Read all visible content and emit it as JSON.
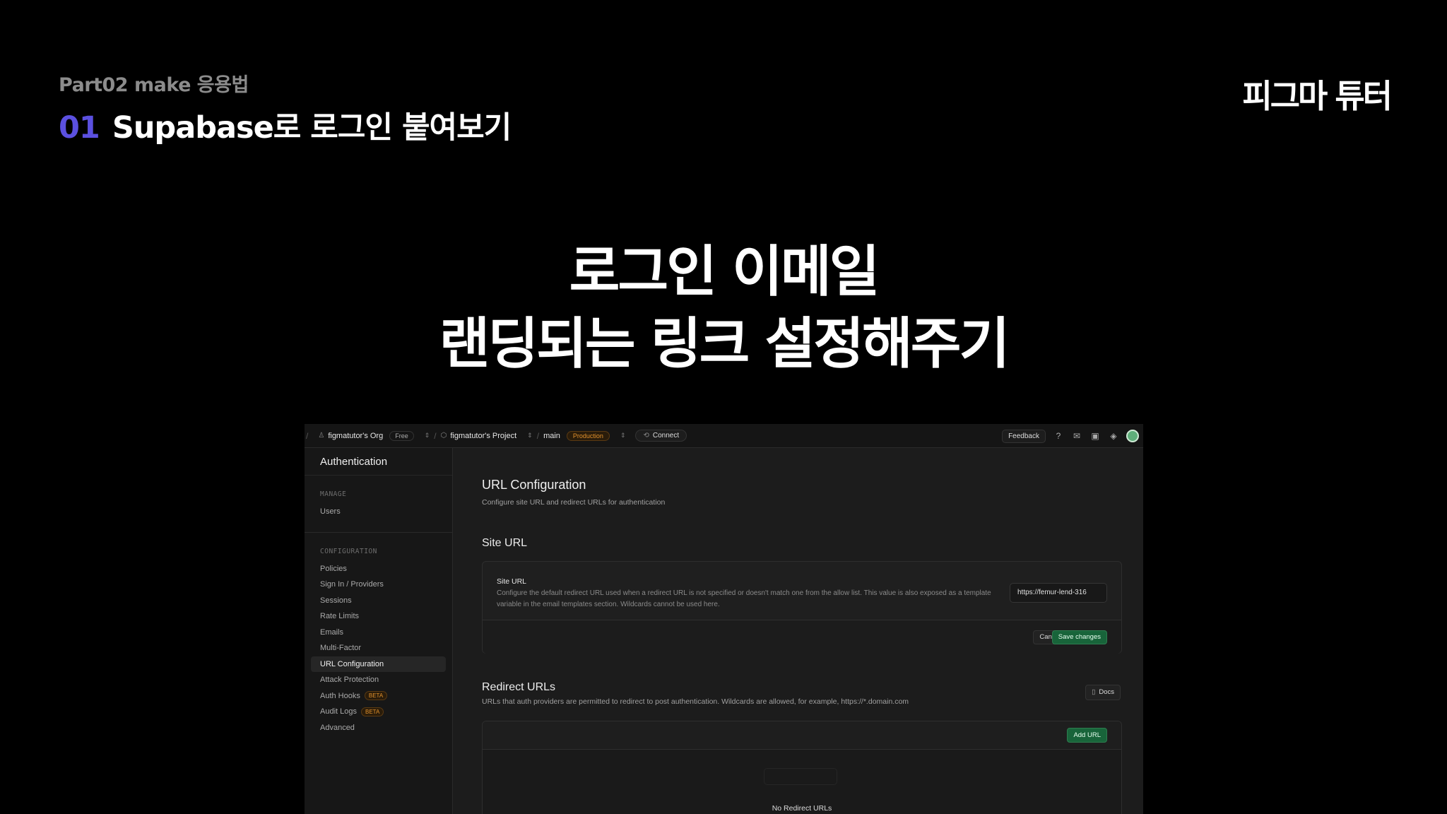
{
  "slide": {
    "subtitle": "Part02 make 응용법",
    "number": "01",
    "title": "Supabase로 로그인 붙여보기",
    "brand": "피그마 튜터",
    "headline_line1": "로그인 이메일",
    "headline_line2": "랜딩되는 링크 설정해주기"
  },
  "topbar": {
    "org": "figmatutor's Org",
    "org_plan": "Free",
    "project": "figmatutor's Project",
    "branch": "main",
    "env": "Production",
    "connect": "Connect",
    "feedback": "Feedback"
  },
  "sidebar": {
    "title": "Authentication",
    "manage_label": "MANAGE",
    "manage_items": [
      "Users"
    ],
    "config_label": "CONFIGURATION",
    "config_items": [
      "Policies",
      "Sign In / Providers",
      "Sessions",
      "Rate Limits",
      "Emails",
      "Multi-Factor",
      "URL Configuration",
      "Attack Protection",
      "Auth Hooks",
      "Audit Logs",
      "Advanced"
    ],
    "active_item": "URL Configuration",
    "beta_badge": "BETA"
  },
  "main": {
    "title": "URL Configuration",
    "subtitle": "Configure site URL and redirect URLs for authentication",
    "site_url_heading": "Site URL",
    "site_url_label": "Site URL",
    "site_url_desc": "Configure the default redirect URL used when a redirect URL is not specified or doesn't match one from the allow list. This value is also exposed as a template variable in the email templates section. Wildcards cannot be used here.",
    "site_url_value": "https://femur-lend-316",
    "cancel": "Cancel",
    "save": "Save changes",
    "redirect_heading": "Redirect URLs",
    "redirect_desc": "URLs that auth providers are permitted to redirect to post authentication. Wildcards are allowed, for example, https://*.domain.com",
    "docs": "Docs",
    "add_url": "Add URL",
    "empty": "No Redirect URLs"
  }
}
